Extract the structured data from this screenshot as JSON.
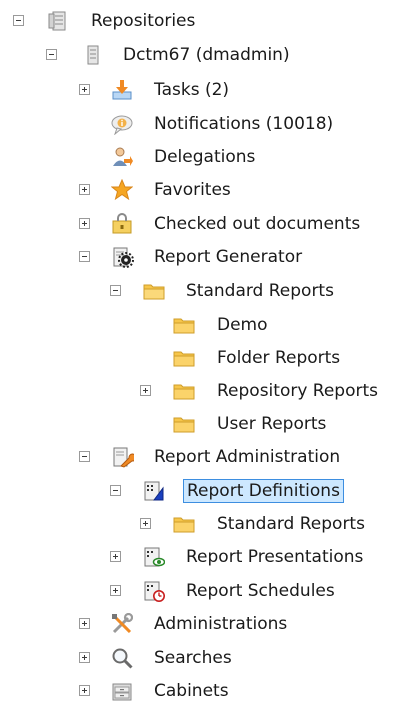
{
  "tree": {
    "root": {
      "label": "Repositories",
      "icon": "repositories-server-icon"
    },
    "repository": {
      "label": "Dctm67 (dmadmin)",
      "icon": "repository-server-icon"
    },
    "tasks": {
      "label": "Tasks (2)",
      "icon": "inbox-download-icon"
    },
    "notifications": {
      "label": "Notifications (10018)",
      "icon": "notification-info-icon"
    },
    "delegations": {
      "label": "Delegations",
      "icon": "delegate-user-icon"
    },
    "favorites": {
      "label": "Favorites",
      "icon": "star-icon"
    },
    "checked_out": {
      "label": "Checked out documents",
      "icon": "lock-folder-icon"
    },
    "report_generator": {
      "label": "Report Generator",
      "icon": "report-generator-gear-icon"
    },
    "gen_standard_reports": {
      "label": "Standard Reports",
      "icon": "folder-open-icon"
    },
    "demo": {
      "label": "Demo",
      "icon": "folder-icon"
    },
    "folder_reports": {
      "label": "Folder Reports",
      "icon": "folder-icon"
    },
    "repository_reports": {
      "label": "Repository Reports",
      "icon": "folder-icon"
    },
    "user_reports": {
      "label": "User Reports",
      "icon": "folder-icon"
    },
    "report_administration": {
      "label": "Report Administration",
      "icon": "report-admin-wrench-icon"
    },
    "report_definitions": {
      "label": "Report Definitions",
      "icon": "report-definition-icon"
    },
    "def_standard_reports": {
      "label": "Standard Reports",
      "icon": "folder-icon"
    },
    "report_presentations": {
      "label": "Report Presentations",
      "icon": "report-presentation-icon"
    },
    "report_schedules": {
      "label": "Report Schedules",
      "icon": "report-schedule-clock-icon"
    },
    "administrations": {
      "label": "Administrations",
      "icon": "tools-icon"
    },
    "searches": {
      "label": "Searches",
      "icon": "magnifier-icon"
    },
    "cabinets": {
      "label": "Cabinets",
      "icon": "cabinet-icon"
    }
  },
  "colors": {
    "selection_bg": "#cde8ff",
    "selection_border": "#3d8ee0",
    "folder": "#f7c64a"
  }
}
